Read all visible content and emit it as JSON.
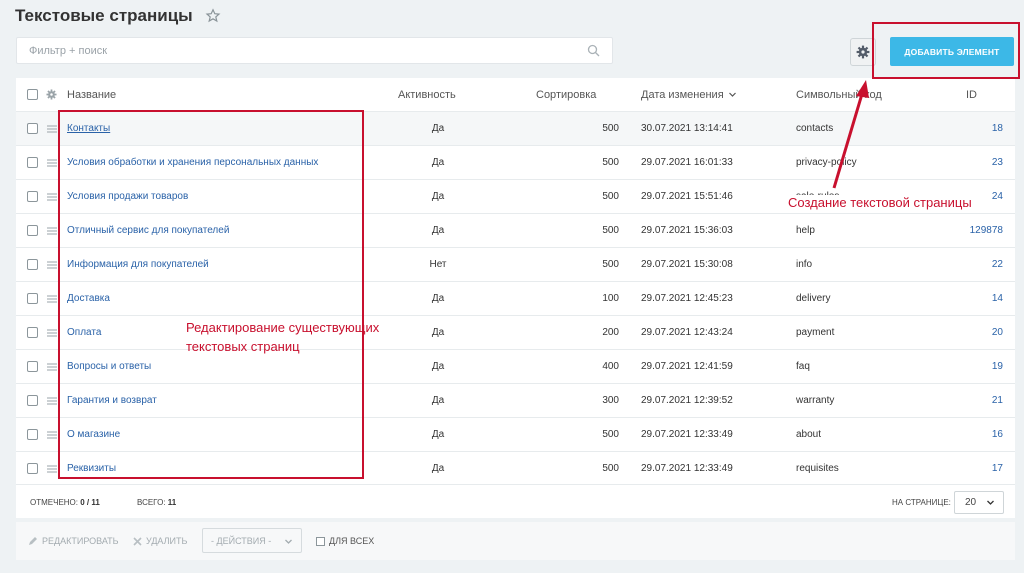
{
  "page": {
    "title": "Текстовые страницы"
  },
  "filter": {
    "placeholder": "Фильтр + поиск"
  },
  "toolbar": {
    "add_label": "ДОБАВИТЬ ЭЛЕМЕНТ"
  },
  "table": {
    "headers": {
      "name": "Название",
      "active": "Активность",
      "sort": "Сортировка",
      "date": "Дата изменения",
      "code": "Символьный код",
      "id": "ID"
    },
    "rows": [
      {
        "name": "Контакты",
        "active": "Да",
        "sort": "500",
        "date": "30.07.2021 13:14:41",
        "code": "contacts",
        "id": "18"
      },
      {
        "name": "Условия обработки и хранения персональных данных",
        "active": "Да",
        "sort": "500",
        "date": "29.07.2021 16:01:33",
        "code": "privacy-policy",
        "id": "23"
      },
      {
        "name": "Условия продажи товаров",
        "active": "Да",
        "sort": "500",
        "date": "29.07.2021 15:51:46",
        "code": "sale-rules",
        "id": "24"
      },
      {
        "name": "Отличный сервис для покупателей",
        "active": "Да",
        "sort": "500",
        "date": "29.07.2021 15:36:03",
        "code": "help",
        "id": "129878"
      },
      {
        "name": "Информация для покупателей",
        "active": "Нет",
        "sort": "500",
        "date": "29.07.2021 15:30:08",
        "code": "info",
        "id": "22"
      },
      {
        "name": "Доставка",
        "active": "Да",
        "sort": "100",
        "date": "29.07.2021 12:45:23",
        "code": "delivery",
        "id": "14"
      },
      {
        "name": "Оплата",
        "active": "Да",
        "sort": "200",
        "date": "29.07.2021 12:43:24",
        "code": "payment",
        "id": "20"
      },
      {
        "name": "Вопросы и ответы",
        "active": "Да",
        "sort": "400",
        "date": "29.07.2021 12:41:59",
        "code": "faq",
        "id": "19"
      },
      {
        "name": "Гарантия и возврат",
        "active": "Да",
        "sort": "300",
        "date": "29.07.2021 12:39:52",
        "code": "warranty",
        "id": "21"
      },
      {
        "name": "О магазине",
        "active": "Да",
        "sort": "500",
        "date": "29.07.2021 12:33:49",
        "code": "about",
        "id": "16"
      },
      {
        "name": "Реквизиты",
        "active": "Да",
        "sort": "500",
        "date": "29.07.2021 12:33:49",
        "code": "requisites",
        "id": "17"
      }
    ]
  },
  "footer": {
    "marked_label": "ОТМЕЧЕНО:",
    "marked_value": "0 / 11",
    "total_label": "ВСЕГО:",
    "total_value": "11",
    "per_page_label": "НА СТРАНИЦЕ:",
    "per_page_value": "20"
  },
  "actions": {
    "edit": "РЕДАКТИРОВАТЬ",
    "delete": "УДАЛИТЬ",
    "select": "- ДЕЙСТВИЯ -",
    "for_all": "ДЛЯ ВСЕХ"
  },
  "annotations": {
    "edit_existing": "Редактирование существующих текстовых страниц",
    "create_new": "Создание текстовой страницы"
  },
  "colors": {
    "accent": "#3cb8e7",
    "link": "#2a62a8",
    "annotation": "#c8102e"
  }
}
